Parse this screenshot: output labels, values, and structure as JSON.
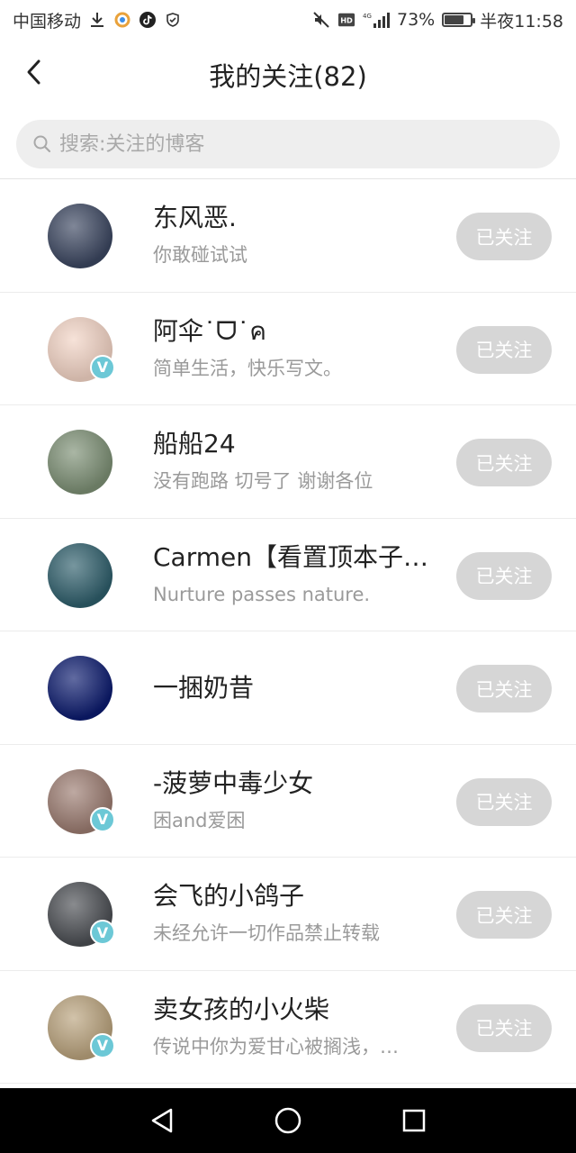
{
  "status_bar": {
    "carrier": "中国移动",
    "right_text": "73%",
    "time": "半夜11:58",
    "battery_level": 0.73,
    "icons_left": [
      "download-icon",
      "app-icon",
      "tiktok-icon",
      "shield-icon"
    ],
    "icons_right": [
      "mute-icon",
      "hd-icon",
      "4g-signal-icon",
      "battery-icon"
    ]
  },
  "header": {
    "title": "我的关注(82)",
    "back_icon": "chevron-left-icon"
  },
  "search": {
    "placeholder": "搜索:关注的博客",
    "value": ""
  },
  "follow_label": "已关注",
  "list": [
    {
      "name": "东风恶.",
      "bio": "你敢碰试试",
      "verified": false,
      "avatar_color": "#3b4660"
    },
    {
      "name": "阿伞˙ᗜ˙ค",
      "bio": "简单生活，快乐写文。",
      "verified": true,
      "avatar_color": "#f2d3c4"
    },
    {
      "name": "船船24",
      "bio": "没有跑路 切号了 谢谢各位",
      "verified": false,
      "avatar_color": "#7c8f74"
    },
    {
      "name": "Carmen【看置顶本子…",
      "bio": "Nurture passes nature.",
      "verified": false,
      "avatar_color": "#2e5e6b"
    },
    {
      "name": "一捆奶昔",
      "bio": "",
      "verified": false,
      "avatar_color": "#0c1b6e"
    },
    {
      "name": "-菠萝中毒少女",
      "bio": "困and爱困",
      "verified": true,
      "avatar_color": "#9b7b70"
    },
    {
      "name": "会飞的小鸽子",
      "bio": "未经允许一切作品禁止转载",
      "verified": true,
      "avatar_color": "#4a4d52"
    },
    {
      "name": "卖女孩的小火柴",
      "bio": "传说中你为爱甘心被搁浅，…",
      "verified": true,
      "avatar_color": "#b9a27c"
    }
  ],
  "nav": {
    "back_icon": "triangle-back-icon",
    "home_icon": "circle-home-icon",
    "recents_icon": "square-recents-icon"
  },
  "colors": {
    "follow_button_bg": "#d6d6d6",
    "verified_badge": "#6cc8d6",
    "search_bg": "#eeeeee",
    "nav_bg": "#000000"
  }
}
